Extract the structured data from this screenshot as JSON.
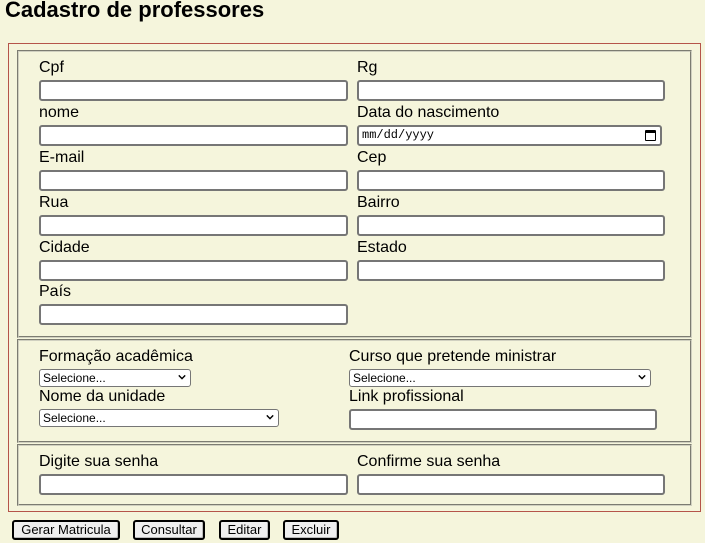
{
  "page_title": "Cadastro de professores",
  "personal": {
    "cpf_label": "Cpf",
    "rg_label": "Rg",
    "nome_label": "nome",
    "nascimento_label": "Data do nascimento",
    "nascimento_placeholder": "mm/dd/yyyy",
    "email_label": "E-mail",
    "cep_label": "Cep",
    "rua_label": "Rua",
    "bairro_label": "Bairro",
    "cidade_label": "Cidade",
    "estado_label": "Estado",
    "pais_label": "País"
  },
  "academic": {
    "formacao_label": "Formação acadêmica",
    "formacao_selected": "Selecione...",
    "curso_label": "Curso que pretende ministrar",
    "curso_selected": "Selecione...",
    "unidade_label": "Nome da unidade",
    "unidade_selected": "Selecione...",
    "link_label": "Link profissional"
  },
  "security": {
    "senha_label": "Digite sua senha",
    "confirma_label": "Confirme sua senha"
  },
  "buttons": {
    "gerar": "Gerar Matricula",
    "consultar": "Consultar",
    "editar": "Editar",
    "excluir": "Excluir"
  }
}
